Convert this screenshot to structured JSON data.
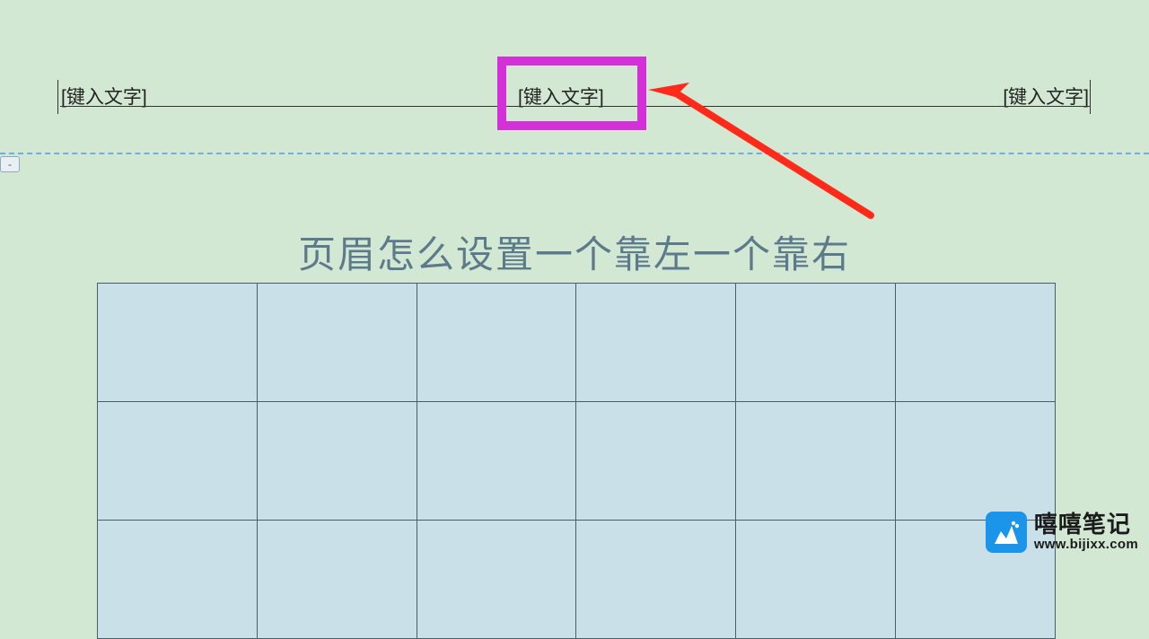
{
  "header": {
    "left_placeholder": "[键入文字]",
    "center_placeholder": "[键入文字]",
    "right_placeholder": "[键入文字]"
  },
  "tab_marker": "-",
  "title": "页眉怎么设置一个靠左一个靠右",
  "table": {
    "rows": 3,
    "cols": 6
  },
  "watermark": {
    "brand": "嘻嘻笔记",
    "url": "www.bijixx.com"
  },
  "annotation": {
    "highlight": "center_field",
    "arrow": "points_to_center"
  }
}
